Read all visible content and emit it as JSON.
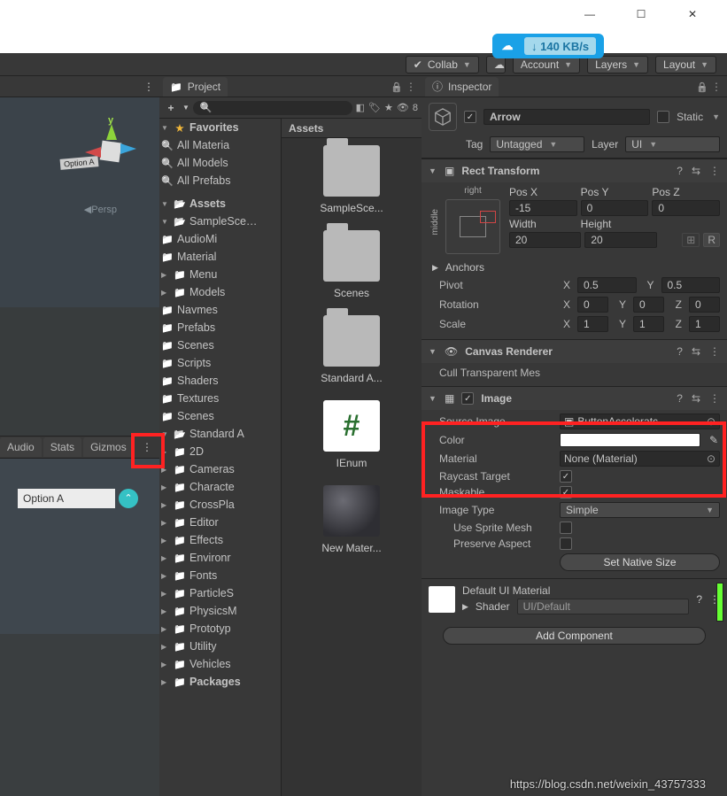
{
  "window_controls": {
    "minimize": "—",
    "maximize": "☐",
    "close": "✕"
  },
  "network": {
    "rate": "140 KB/s",
    "arrow": "↓"
  },
  "top_toolbar": {
    "collab": "Collab",
    "account": "Account",
    "layers": "Layers",
    "layout": "Layout"
  },
  "scene": {
    "persp": "Persp",
    "persp_arrow": "◀",
    "option_chip": "Option A",
    "gizmo_y": "y",
    "tabs": {
      "audio": "Audio",
      "stats": "Stats",
      "gizmos": "Gizmos"
    },
    "option_a_input": "Option A"
  },
  "project": {
    "tab": "Project",
    "icons_label": "8",
    "plus": "+",
    "favorites": "Favorites",
    "fav_items": [
      "All Materia",
      "All Models",
      "All Prefabs"
    ],
    "assets": "Assets",
    "sample_scene": "SampleSce…",
    "sample_items": [
      "AudioMi",
      "Material",
      "Menu",
      "Models",
      "Navmes",
      "Prefabs",
      "Scenes",
      "Scripts",
      "Shaders",
      "Textures"
    ],
    "scenes_root": "Scenes",
    "standard_assets": "Standard A",
    "sa_items": [
      "2D",
      "Cameras",
      "Characte",
      "CrossPla",
      "Editor",
      "Effects",
      "Environr",
      "Fonts",
      "ParticleS",
      "PhysicsM",
      "Prototyp",
      "Utility",
      "Vehicles"
    ],
    "packages": "Packages"
  },
  "grid": {
    "header": "Assets",
    "items": [
      "SampleSce...",
      "Scenes",
      "Standard A...",
      "IEnum",
      "New Mater..."
    ]
  },
  "inspector": {
    "tab": "Inspector",
    "object_name": "Arrow",
    "static": "Static",
    "tag_label": "Tag",
    "tag_value": "Untagged",
    "layer_label": "Layer",
    "layer_value": "UI",
    "rect_transform": {
      "title": "Rect Transform",
      "anchor_h": "right",
      "anchor_v": "middle",
      "posx_l": "Pos X",
      "posy_l": "Pos Y",
      "posz_l": "Pos Z",
      "posx": "-15",
      "posy": "0",
      "posz": "0",
      "width_l": "Width",
      "height_l": "Height",
      "width": "20",
      "height": "20",
      "anchors": "Anchors",
      "pivot": "Pivot",
      "pivot_x": "0.5",
      "pivot_y": "0.5",
      "rotation": "Rotation",
      "rot_x": "0",
      "rot_y": "0",
      "rot_z": "0",
      "scale": "Scale",
      "scl_x": "1",
      "scl_y": "1",
      "scl_z": "1"
    },
    "canvas_renderer": {
      "title": "Canvas Renderer",
      "cull": "Cull Transparent Mes"
    },
    "image": {
      "title": "Image",
      "source_l": "Source Image",
      "source_v": "ButtonAcceleratc",
      "color_l": "Color",
      "material_l": "Material",
      "material_v": "None (Material)",
      "raycast_l": "Raycast Target",
      "maskable_l": "Maskable",
      "imgtype_l": "Image Type",
      "imgtype_v": "Simple",
      "usesprite_l": "Use Sprite Mesh",
      "preserve_l": "Preserve Aspect",
      "setnative": "Set Native Size"
    },
    "default_material": {
      "title": "Default UI Material",
      "shader_l": "Shader",
      "shader_v": "UI/Default"
    },
    "add_component": "Add Component"
  },
  "watermark": "https://blog.csdn.net/weixin_43757333"
}
